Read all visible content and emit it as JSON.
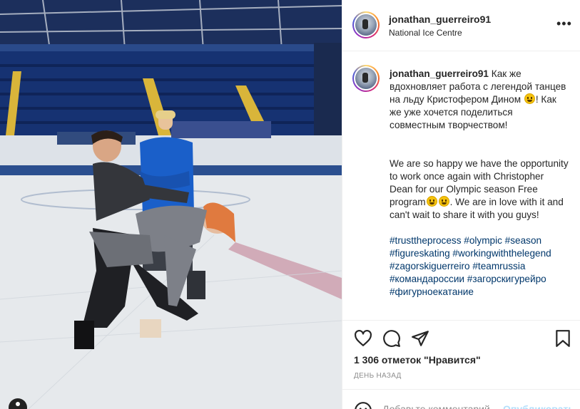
{
  "post": {
    "username": "jonathan_guerreiro91",
    "location": "National Ice Centre",
    "more_glyph": "•••"
  },
  "caption": {
    "username": "jonathan_guerreiro91",
    "ru_part1": "Как же вдохновляет работа с легендой танцев на льду Кристофером Дином",
    "ru_part2": "! Как же уже хочется поделиться совместным творчеством!",
    "en_part1": "We are so happy we have the opportunity to work once again with Christopher Dean for our Olympic season Free program",
    "en_part2": ". We are in love with it and can't wait to share it with you guys!",
    "hashtags": "#trusttheprocess #olympic #season #figureskating #workingwiththelegend #zagorskiguerreiro #teamrussia #командароссии #загорскигурейро #фигурноекатание"
  },
  "actions": {
    "like_icon": "heart-icon",
    "comment_icon": "speech-bubble-icon",
    "share_icon": "paper-plane-icon",
    "save_icon": "bookmark-icon",
    "likes_text": "1 306 отметок \"Нравится\"",
    "time_ago": "ДЕНЬ НАЗАД"
  },
  "comment": {
    "placeholder": "Добавьте комментарий...",
    "publish_label": "Опубликовать",
    "emoji_icon": "smiley-icon"
  },
  "colors": {
    "link": "#00376b",
    "muted": "#8e8e8e",
    "publish_disabled": "#b2dffc"
  }
}
